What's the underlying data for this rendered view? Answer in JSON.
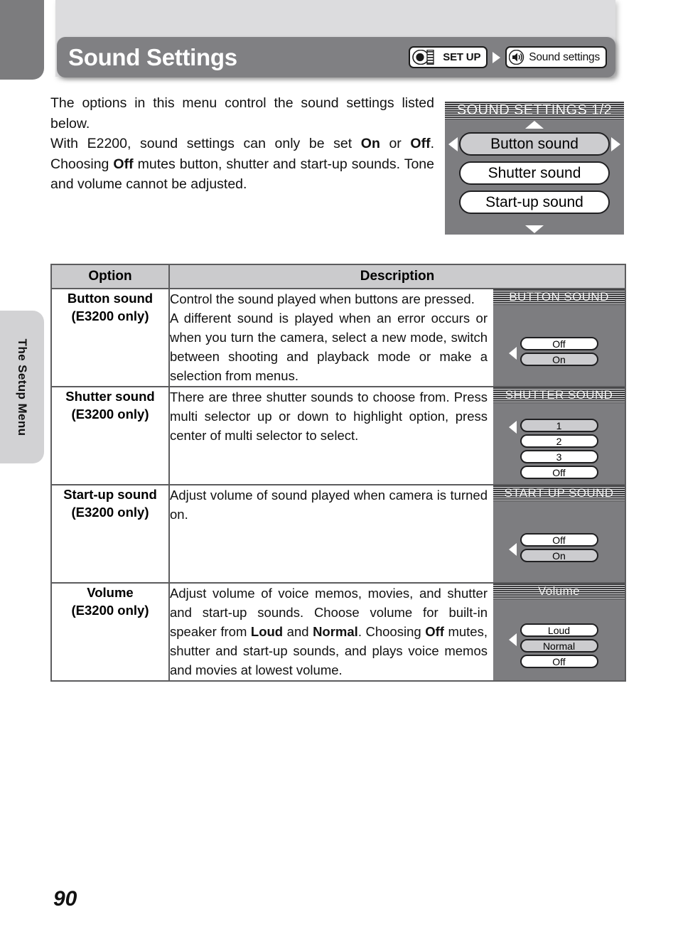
{
  "page": {
    "title": "Sound Settings",
    "number": "90",
    "side_tab_label": "The Setup Menu"
  },
  "breadcrumb": {
    "setup_badge": {
      "icon": "mode-dial-icon",
      "label": "SET UP"
    },
    "arrow": "triangle-right-icon",
    "current_badge": {
      "icon": "speaker-icon",
      "label": "Sound settings"
    }
  },
  "intro": {
    "line1": "The options in this menu control the sound settings listed below.",
    "para2_a": "With E2200, sound settings can only be set ",
    "para2_b1": "On",
    "para2_c": " or ",
    "para2_b2": "Off",
    "para2_d": ". Choosing ",
    "para2_b3": "Off",
    "para2_e": " mutes button, shutter and start-up sounds. Tone and volume cannot be adjusted."
  },
  "lcd_main": {
    "title": "SOUND SETTINGS 1/2",
    "items": [
      {
        "label": "Button sound",
        "selected": true
      },
      {
        "label": "Shutter sound",
        "selected": false
      },
      {
        "label": "Start-up sound",
        "selected": false
      }
    ],
    "arrows": [
      "up",
      "down",
      "left",
      "right"
    ]
  },
  "table": {
    "headers": {
      "option": "Option",
      "description": "Description"
    },
    "rows": [
      {
        "option_name": "Button sound",
        "option_note": "(E3200 only)",
        "desc_lines": [
          "Control the sound played when buttons are pressed.",
          "A different sound is played when an error occurs or when you turn the camera, select a new mode, switch between shooting and playback mode or make a selection from menus."
        ],
        "screen": {
          "title": "BUTTON SOUND",
          "items": [
            {
              "label": "Off",
              "selected": false
            },
            {
              "label": "On",
              "selected": true
            }
          ]
        }
      },
      {
        "option_name": "Shutter sound",
        "option_note": "(E3200 only)",
        "desc_lines": [
          "There are three shutter sounds to choose from. Press multi selector up or down to highlight option, press center of multi selector to select."
        ],
        "screen": {
          "title": "SHUTTER SOUND",
          "items": [
            {
              "label": "1",
              "selected": true
            },
            {
              "label": "2",
              "selected": false
            },
            {
              "label": "3",
              "selected": false
            },
            {
              "label": "Off",
              "selected": false
            }
          ]
        }
      },
      {
        "option_name": "Start-up sound",
        "option_note": "(E3200 only)",
        "desc_lines": [
          "Adjust volume of sound played when camera is turned on."
        ],
        "screen": {
          "title": "START-UP SOUND",
          "items": [
            {
              "label": "Off",
              "selected": false
            },
            {
              "label": "On",
              "selected": true
            }
          ]
        }
      },
      {
        "option_name": "Volume",
        "option_note": "(E3200 only)",
        "desc_rich": [
          {
            "t": "Adjust volume of voice memos, movies, and shutter and start-up sounds. Choose volume for built-in speaker from ",
            "b": false
          },
          {
            "t": "Loud",
            "b": true
          },
          {
            "t": " and ",
            "b": false
          },
          {
            "t": "Normal",
            "b": true
          },
          {
            "t": ". Choosing ",
            "b": false
          },
          {
            "t": "Off",
            "b": true
          },
          {
            "t": " mutes, shutter and start-up sounds, and plays voice memos and movies at lowest volume.",
            "b": false
          }
        ],
        "screen": {
          "title": "Volume",
          "items": [
            {
              "label": "Loud",
              "selected": false
            },
            {
              "label": "Normal",
              "selected": true
            },
            {
              "label": "Off",
              "selected": false
            }
          ]
        }
      }
    ]
  },
  "colors": {
    "title_bar": "#808083",
    "header_band": "#dcdcde",
    "lcd_bg": "#7d7d80",
    "selected_pill": "#cccccf",
    "table_header": "#cbcbcd",
    "table_border": "#5c5c5e"
  }
}
